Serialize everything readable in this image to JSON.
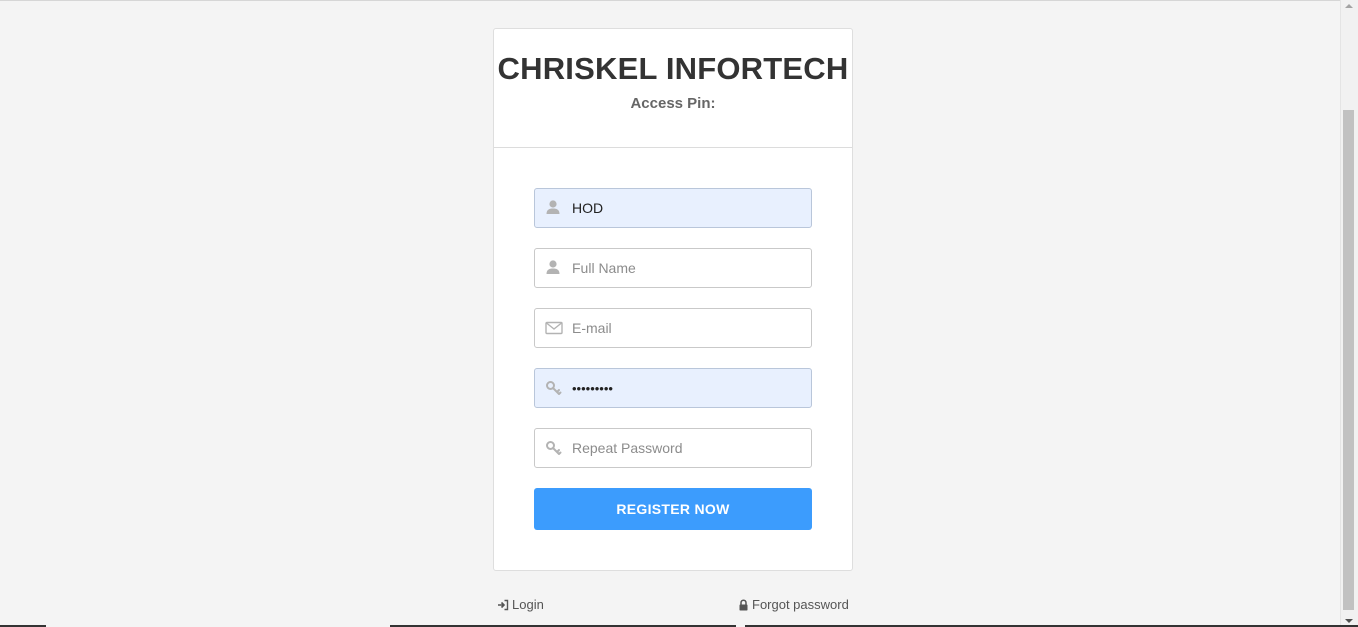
{
  "brand": "CHRISKEL INFORTECH",
  "subtitle": "Access Pin:",
  "form": {
    "username": {
      "value": "HOD",
      "icon": "user-icon"
    },
    "fullname": {
      "placeholder": "Full Name",
      "icon": "user-icon"
    },
    "email": {
      "placeholder": "E-mail",
      "icon": "envelope-icon"
    },
    "password": {
      "value": "•••••••••",
      "icon": "key-icon"
    },
    "repeat_password": {
      "placeholder": "Repeat Password",
      "icon": "key-icon"
    },
    "submit_label": "REGISTER NOW"
  },
  "footer": {
    "login_label": "Login",
    "login_icon": "sign-in-icon",
    "forgot_label": "Forgot password",
    "forgot_icon": "lock-icon"
  },
  "colors": {
    "accent": "#3c9cfd",
    "autofill": "#e8f0fe",
    "background": "#f4f4f4"
  }
}
